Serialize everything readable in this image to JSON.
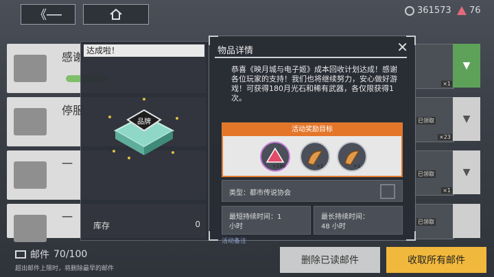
{
  "top": {
    "back_icon": "back-arrow-icon",
    "home_icon": "home-icon"
  },
  "currency": {
    "crystal": "361573",
    "ticket": "76"
  },
  "mail_list": [
    {
      "title": "感谢"
    },
    {
      "title": "停服"
    },
    {
      "title": "一"
    },
    {
      "title": "一"
    }
  ],
  "side_items": [
    {
      "count": "×1",
      "tag": ""
    },
    {
      "count": "×23",
      "tag": "已领取"
    },
    {
      "count": "×1",
      "tag": "已领取"
    },
    {
      "count": "×1",
      "tag": "已领取"
    }
  ],
  "left_panel": {
    "header": "达成啦！",
    "stock_label": "库存",
    "stock_value": "0"
  },
  "item_detail": {
    "title": "物品详情",
    "description": "恭喜《映月城与电子姬》成本回收计划达成！感谢各位玩家的支持！我们也将继续努力，安心做好游戏！可获得180月光石和稀有武器，各仅限获得1次。",
    "reward_header": "活动奖励目标",
    "rewards": [
      {
        "name": "moonstone-icon",
        "count": "×180"
      },
      {
        "name": "weapon-icon-1",
        "count": "×1"
      },
      {
        "name": "weapon-icon-2",
        "count": "×1"
      }
    ],
    "type_label": "类型：都市传说协会",
    "min_time_label": "最短持续时间：1",
    "min_time_unit": "小时",
    "max_time_label": "最长持续时间：",
    "max_time_value": "48 小时",
    "partial_label": "活动备注"
  },
  "bottom": {
    "mail_label": "邮件",
    "mail_count": "70/100",
    "note": "超出邮件上限时，将删除最早的邮件",
    "delete_read": "删除已读邮件",
    "claim_all": "收取所有邮件"
  },
  "colors": {
    "accent_orange": "#e4762a",
    "claim_yellow": "#f0b83c"
  }
}
